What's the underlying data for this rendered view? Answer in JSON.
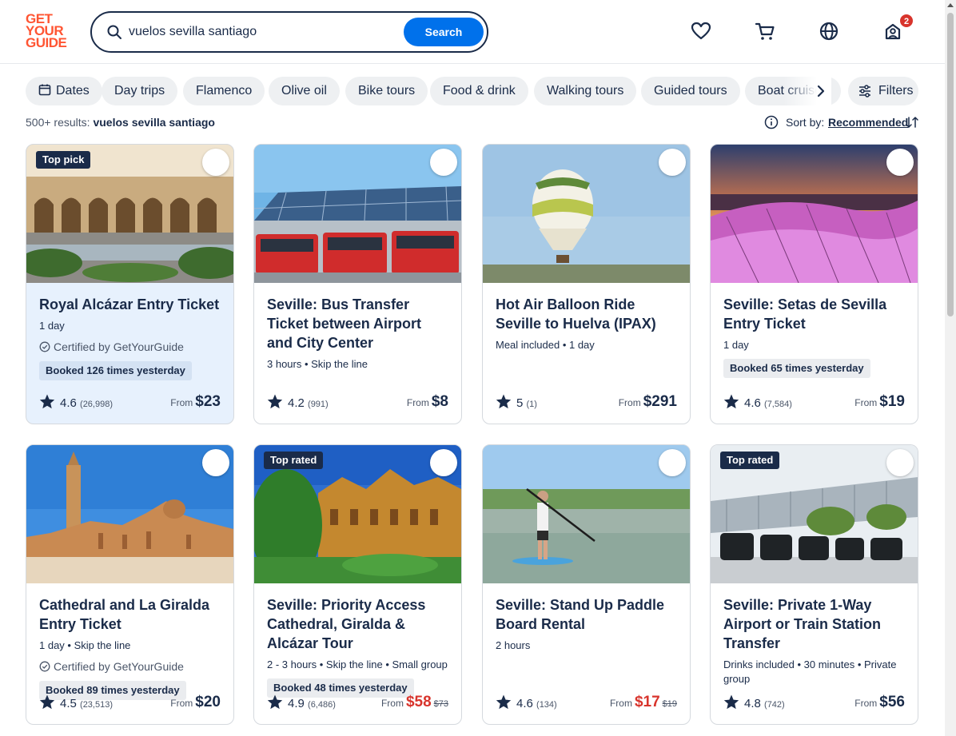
{
  "header": {
    "logo_lines": [
      "GET",
      "YOUR",
      "GUIDE"
    ],
    "search_value": "vuelos sevilla santiago",
    "search_button": "Search",
    "notification_count": "2"
  },
  "chips": [
    "Dates",
    "Day trips",
    "Flamenco",
    "Olive oil",
    "Bike tours",
    "Food & drink",
    "Walking tours",
    "Guided tours",
    "Boat cruises"
  ],
  "filters_label": "Filters",
  "results": {
    "count_prefix": "500+ results:",
    "query": "vuelos sevilla santiago",
    "sort_label": "Sort by:",
    "sort_value": "Recommended"
  },
  "cards": [
    {
      "tag": "Top pick",
      "title": "Royal Alcázar Entry Ticket",
      "meta": "1 day",
      "certified": "Certified by GetYourGuide",
      "booked": "Booked 126 times yesterday",
      "rating": "4.6",
      "reviews": "(26,998)",
      "from": "From",
      "price": "$23",
      "old_price": ""
    },
    {
      "tag": "",
      "title": "Seville: Bus Transfer Ticket between Airport and City Center",
      "meta": "3 hours • Skip the line",
      "certified": "",
      "booked": "",
      "rating": "4.2",
      "reviews": "(991)",
      "from": "From",
      "price": "$8",
      "old_price": ""
    },
    {
      "tag": "",
      "title": "Hot Air Balloon Ride Seville to Huelva (IPAX)",
      "meta": "Meal included • 1 day",
      "certified": "",
      "booked": "",
      "rating": "5",
      "reviews": "(1)",
      "from": "From",
      "price": "$291",
      "old_price": ""
    },
    {
      "tag": "",
      "title": "Seville: Setas de Sevilla Entry Ticket",
      "meta": "1 day",
      "certified": "",
      "booked": "Booked 65 times yesterday",
      "rating": "4.6",
      "reviews": "(7,584)",
      "from": "From",
      "price": "$19",
      "old_price": ""
    },
    {
      "tag": "",
      "title": "Cathedral and La Giralda Entry Ticket",
      "meta": "1 day • Skip the line",
      "certified": "Certified by GetYourGuide",
      "booked": "Booked 89 times yesterday",
      "rating": "4.5",
      "reviews": "(23,513)",
      "from": "From",
      "price": "$20",
      "old_price": ""
    },
    {
      "tag": "Top rated",
      "title": "Seville: Priority Access Cathedral, Giralda & Alcázar Tour",
      "meta": "2 - 3 hours • Skip the line • Small group",
      "certified": "",
      "booked": "Booked 48 times yesterday",
      "rating": "4.9",
      "reviews": "(6,486)",
      "from": "From",
      "price": "$58",
      "old_price": "$73"
    },
    {
      "tag": "",
      "title": "Seville: Stand Up Paddle Board Rental",
      "meta": "2 hours",
      "certified": "",
      "booked": "",
      "rating": "4.6",
      "reviews": "(134)",
      "from": "From",
      "price": "$17",
      "old_price": "$19"
    },
    {
      "tag": "Top rated",
      "title": "Seville: Private 1-Way Airport or Train Station Transfer",
      "meta": "Drinks included • 30 minutes • Private group",
      "certified": "",
      "booked": "",
      "rating": "4.8",
      "reviews": "(742)",
      "from": "From",
      "price": "$56",
      "old_price": ""
    }
  ],
  "colors": {
    "brand": "#ff5533",
    "primary": "#0071eb",
    "navy": "#1a2b49",
    "sale": "#d8342c",
    "highlight": "#e7f1fd"
  }
}
